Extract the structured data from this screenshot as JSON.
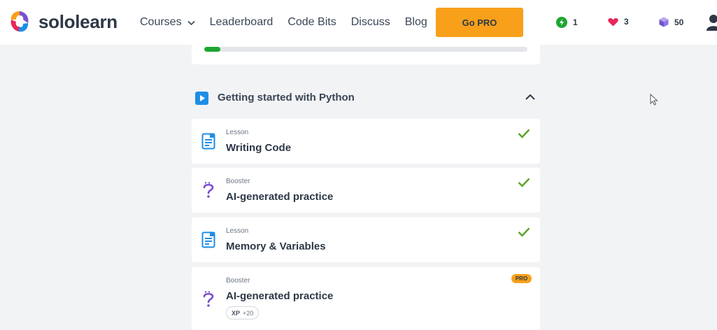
{
  "brand": {
    "name": "sololearn"
  },
  "nav": {
    "items": [
      {
        "label": "Courses",
        "has_dropdown": true
      },
      {
        "label": "Leaderboard"
      },
      {
        "label": "Code Bits"
      },
      {
        "label": "Discuss"
      },
      {
        "label": "Blog"
      }
    ],
    "go_pro_label": "Go PRO"
  },
  "stats": {
    "streak": "1",
    "hearts": "3",
    "gems": "50"
  },
  "course_progress": {
    "fraction": 0.05
  },
  "section": {
    "title": "Getting started with Python",
    "expanded": true
  },
  "lessons": [
    {
      "type": "Lesson",
      "title": "Writing Code",
      "icon": "document-icon",
      "completed": true
    },
    {
      "type": "Booster",
      "title": "AI-generated practice",
      "icon": "question-icon",
      "completed": true
    },
    {
      "type": "Lesson",
      "title": "Memory & Variables",
      "icon": "document-icon",
      "completed": true
    },
    {
      "type": "Booster",
      "title": "AI-generated practice",
      "icon": "question-icon",
      "completed": false,
      "pro_label": "PRO",
      "xp_label": "XP",
      "xp_value": "+20"
    }
  ],
  "colors": {
    "accent_orange": "#f9a01b",
    "progress_green": "#1ea531",
    "check_green": "#5aa427",
    "heart_red": "#e8265a",
    "booster_purple": "#7b4fd1",
    "doc_blue": "#1e8ee6"
  }
}
